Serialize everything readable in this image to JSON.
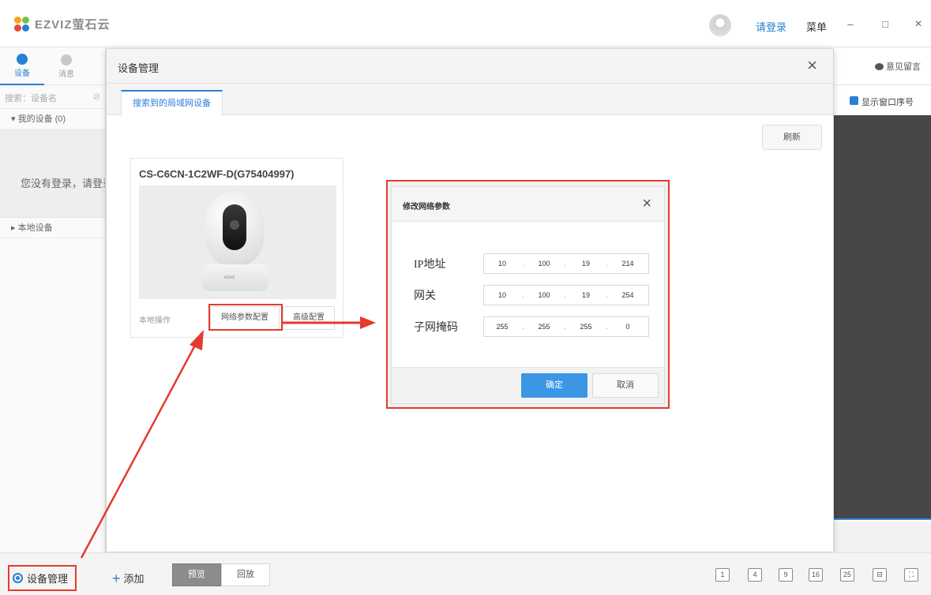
{
  "app": {
    "brand": "EZVIZ萤石云",
    "login_link": "请登录",
    "menu": "菜单"
  },
  "window_controls": {
    "minimize": "–",
    "maximize": "□",
    "close": "×"
  },
  "sidebar": {
    "tabs": [
      {
        "label": "设备"
      },
      {
        "label": "消息"
      }
    ],
    "search_placeholder": "搜索：设备名",
    "my_devices": "▾ 我的设备 (0)",
    "login_hint": "您没有登录，请登录",
    "local_devices": "▸ 本地设备"
  },
  "right_panel": {
    "feedback": "意见留言",
    "show_window_index": "显示窗口序号"
  },
  "device_manager": {
    "title": "设备管理",
    "tab": "搜索到的局域网设备",
    "refresh": "刷新",
    "card": {
      "name": "CS-C6CN-1C2WF-D(G75404997)",
      "brand_on_device": "ezviz",
      "local_ops": "本地操作",
      "net_config_button": "网络参数配置",
      "advanced_button": "高级配置"
    }
  },
  "net_dialog": {
    "title": "修改网络参数",
    "rows": [
      {
        "label": "IP地址",
        "octets": [
          "10",
          "100",
          "19",
          "214"
        ]
      },
      {
        "label": "网关",
        "octets": [
          "10",
          "100",
          "19",
          "254"
        ]
      },
      {
        "label": "子网掩码",
        "octets": [
          "255",
          "255",
          "255",
          "0"
        ]
      }
    ],
    "confirm": "确定",
    "cancel": "取消"
  },
  "bottom_bar": {
    "device_manager": "设备管理",
    "add": "添加",
    "preview": "预览",
    "playback": "回放",
    "layouts": [
      "1",
      "4",
      "9",
      "16",
      "25"
    ]
  },
  "colors": {
    "accent": "#2a7fd4",
    "annotation_red": "#e53a2f",
    "dark_view": "#474747"
  }
}
